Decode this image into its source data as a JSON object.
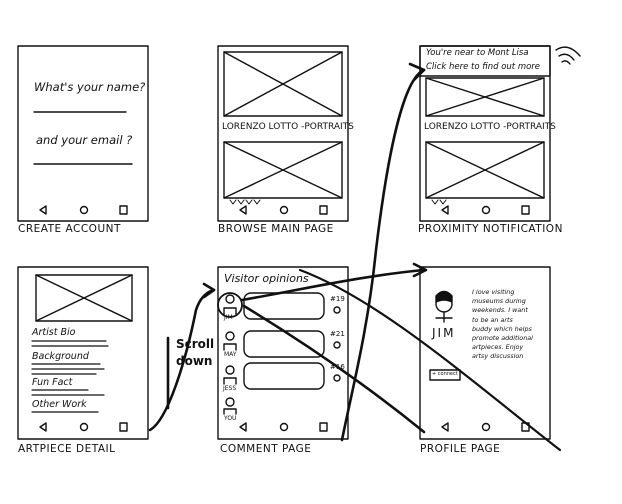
{
  "screens": {
    "create_account": {
      "caption": "CREATE ACCOUNT",
      "name_prompt": "What's your name?",
      "email_prompt": "and your email ?"
    },
    "browse_main": {
      "caption": "BROWSE MAIN PAGE",
      "card_title": "LORENZO LOTTO -PORTRAITS"
    },
    "proximity_notification": {
      "caption": "PROXIMITY NOTIFICATION",
      "notice_line1": "You're near to Mont Lisa",
      "notice_line2": "Click here to find out more",
      "card_title": "LORENZO LOTTO -PORTRAITS"
    },
    "artpiece_detail": {
      "caption": "ARTPIECE DETAIL",
      "sections": [
        "Artist Bio",
        "Background",
        "Fun Fact",
        "Other Work"
      ]
    },
    "comment_page": {
      "caption": "COMMENT PAGE",
      "title": "Visitor opinions",
      "comments": [
        {
          "user": "JIM",
          "likes": "#19"
        },
        {
          "user": "MAY",
          "likes": "#21"
        },
        {
          "user": "JESS",
          "likes": "#16"
        }
      ],
      "self_label": "YOU"
    },
    "profile_page": {
      "caption": "PROFILE PAGE",
      "name": "JIM",
      "bio": [
        "I love visiting",
        "museums during",
        "weekends. I want",
        "to be an arts",
        "buddy which helps",
        "promote additional",
        "artpieces. Enjoy",
        "artsy discussion"
      ],
      "button": "+ connect"
    }
  },
  "annotation": "Scroll down"
}
